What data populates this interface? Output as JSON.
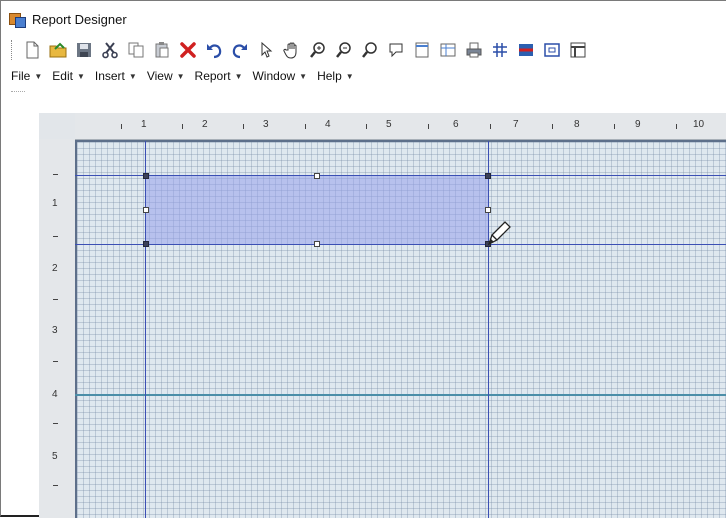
{
  "window": {
    "title": "Report Designer"
  },
  "toolbar": {
    "buttons": [
      {
        "name": "new-icon"
      },
      {
        "name": "open-icon"
      },
      {
        "name": "save-icon"
      },
      {
        "name": "cut-icon"
      },
      {
        "name": "copy-icon"
      },
      {
        "name": "paste-icon"
      },
      {
        "name": "delete-icon"
      },
      {
        "name": "undo-icon"
      },
      {
        "name": "redo-icon"
      },
      {
        "name": "pointer-icon"
      },
      {
        "name": "pan-hand-icon"
      },
      {
        "name": "zoom-in-icon"
      },
      {
        "name": "zoom-out-icon"
      },
      {
        "name": "zoom-icon"
      },
      {
        "name": "zoom-fit-icon"
      },
      {
        "name": "page-icon"
      },
      {
        "name": "layout-icon"
      },
      {
        "name": "print-icon"
      },
      {
        "name": "grid-icon"
      },
      {
        "name": "band-icon"
      },
      {
        "name": "snap-icon"
      },
      {
        "name": "properties-icon"
      }
    ]
  },
  "menu": {
    "items": [
      "File",
      "Edit",
      "Insert",
      "View",
      "Report",
      "Window",
      "Help"
    ]
  },
  "ruler": {
    "horizontal": [
      "1",
      "2",
      "3",
      "4",
      "5",
      "6",
      "7",
      "8",
      "9",
      "10"
    ],
    "vertical": [
      "1",
      "2",
      "3",
      "4",
      "5"
    ]
  },
  "colors": {
    "guide_line": "#3b4fb4",
    "section_line": "#4b8ea8",
    "selection_fill": "#9aa0eb",
    "canvas": "#dfe8ef"
  }
}
